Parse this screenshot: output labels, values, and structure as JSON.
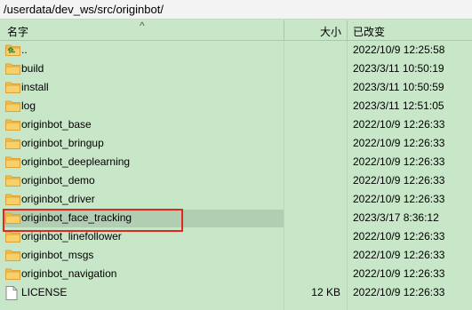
{
  "path": "/userdata/dev_ws/src/originbot/",
  "columns": {
    "name": "名字",
    "size": "大小",
    "modified": "已改变"
  },
  "files": [
    {
      "icon": "parent-folder-icon",
      "name": "..",
      "size": "",
      "modified": "2022/10/9 12:25:58"
    },
    {
      "icon": "folder-icon",
      "name": "build",
      "size": "",
      "modified": "2023/3/11 10:50:19"
    },
    {
      "icon": "folder-icon",
      "name": "install",
      "size": "",
      "modified": "2023/3/11 10:50:59"
    },
    {
      "icon": "folder-icon",
      "name": "log",
      "size": "",
      "modified": "2023/3/11 12:51:05"
    },
    {
      "icon": "folder-icon",
      "name": "originbot_base",
      "size": "",
      "modified": "2022/10/9 12:26:33"
    },
    {
      "icon": "folder-icon",
      "name": "originbot_bringup",
      "size": "",
      "modified": "2022/10/9 12:26:33"
    },
    {
      "icon": "folder-icon",
      "name": "originbot_deeplearning",
      "size": "",
      "modified": "2022/10/9 12:26:33"
    },
    {
      "icon": "folder-icon",
      "name": "originbot_demo",
      "size": "",
      "modified": "2022/10/9 12:26:33"
    },
    {
      "icon": "folder-icon",
      "name": "originbot_driver",
      "size": "",
      "modified": "2022/10/9 12:26:33"
    },
    {
      "icon": "folder-icon",
      "name": "originbot_face_tracking",
      "size": "",
      "modified": "2023/3/17 8:36:12",
      "selected": true
    },
    {
      "icon": "folder-icon",
      "name": "originbot_linefollower",
      "size": "",
      "modified": "2022/10/9 12:26:33"
    },
    {
      "icon": "folder-icon",
      "name": "originbot_msgs",
      "size": "",
      "modified": "2022/10/9 12:26:33"
    },
    {
      "icon": "folder-icon",
      "name": "originbot_navigation",
      "size": "",
      "modified": "2022/10/9 12:26:33"
    },
    {
      "icon": "file-icon",
      "name": "LICENSE",
      "size": "12 KB",
      "modified": "2022/10/9 12:26:33"
    }
  ],
  "colors": {
    "background": "#c8e6c8",
    "selected_row": "#b2ceb2",
    "annotation_box": "#e0281e",
    "folder": "#f2c14e"
  }
}
